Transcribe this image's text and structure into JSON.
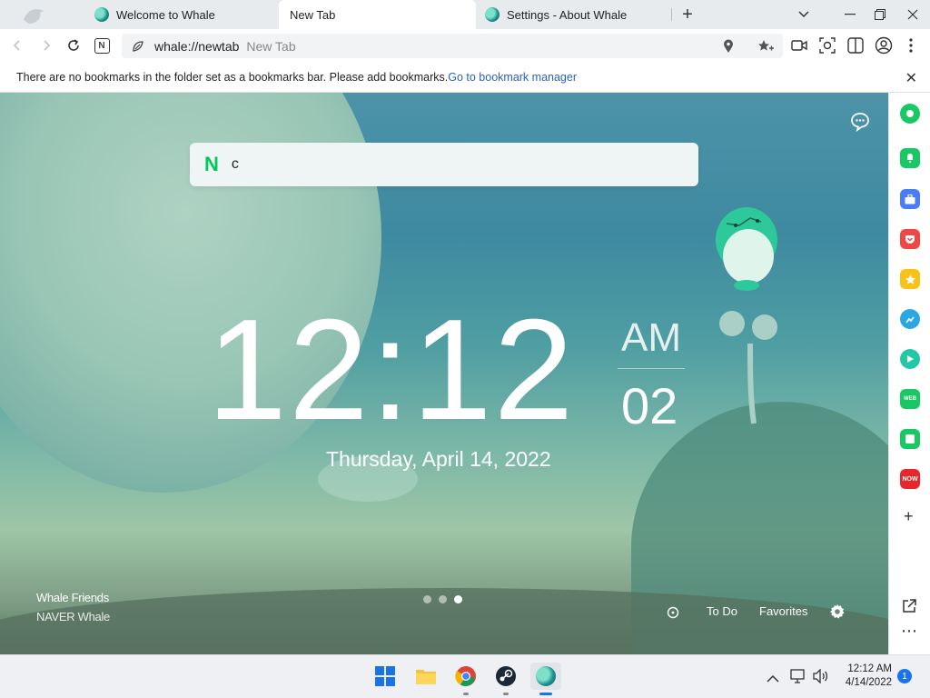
{
  "tabs": [
    {
      "label": "Welcome to Whale",
      "icon": "whale-icon",
      "active": false
    },
    {
      "label": "New Tab",
      "active": true
    },
    {
      "label": "Settings - About Whale",
      "icon": "whale-icon",
      "active": false
    }
  ],
  "window_controls": {
    "tab_search": "⌄",
    "minimize": "—",
    "restore": "❐",
    "close": "✕",
    "new_tab": "+"
  },
  "toolbar": {
    "back": "‹",
    "forward": "›",
    "reload": "↻",
    "naver_button": "N"
  },
  "omnibox": {
    "url": "whale://newtab",
    "ghost_text": "New Tab"
  },
  "bookmark_bar": {
    "message": "There are no bookmarks in the folder set as a bookmarks bar. Please add bookmarks.",
    "link": "Go to bookmark manager",
    "close": "✕"
  },
  "newtab": {
    "search_logo": "N",
    "search_value": "c",
    "time": "12:12",
    "ampm": "AM",
    "seconds": "02",
    "date": "Thursday, April 14, 2022",
    "credit_title": "Whale Friends",
    "credit_subtitle": "NAVER Whale",
    "slides": {
      "count": 3,
      "active": 3
    },
    "bottom_links": {
      "todo": "To Do",
      "favorites": "Favorites"
    }
  },
  "sidebar": {
    "items": [
      "green-circle-icon",
      "bell-icon",
      "briefcase-icon",
      "pocket-icon",
      "star-icon",
      "image-search-icon",
      "play-icon",
      "webtoon-icon",
      "square-icon",
      "now-icon"
    ],
    "add": "+",
    "more": "⋯"
  },
  "taskbar": {
    "time": "12:12 AM",
    "date": "4/14/2022",
    "notification_count": "1"
  },
  "colors": {
    "naver_green": "#03c75a",
    "link_blue": "#2b63b8",
    "sidebar_icons": [
      "#17c864",
      "#17c864",
      "#4a7cf5",
      "#ef4646",
      "#f7c21a",
      "#2aa7e2",
      "#23c7a6",
      "#17c864",
      "#17c864",
      "#e8262b"
    ]
  }
}
